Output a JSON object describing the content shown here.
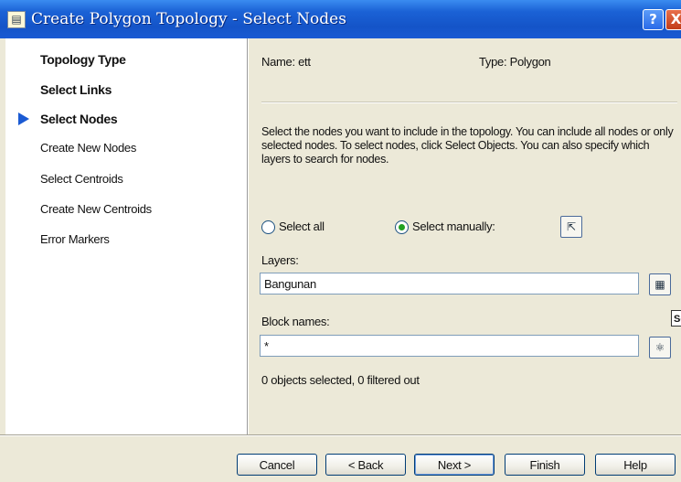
{
  "window": {
    "title": "Create Polygon Topology - Select Nodes",
    "help_label": "?",
    "close_label": "X",
    "app_icon": "map-wizard-icon"
  },
  "sidebar": {
    "steps": [
      {
        "label": "Topology Type",
        "bold": true
      },
      {
        "label": "Select Links",
        "bold": true
      },
      {
        "label": "Select Nodes",
        "bold": true,
        "current": true
      },
      {
        "label": "Create New Nodes",
        "bold": false
      },
      {
        "label": "Select Centroids",
        "bold": false
      },
      {
        "label": "Create New Centroids",
        "bold": false
      },
      {
        "label": "Error Markers",
        "bold": false
      }
    ]
  },
  "main": {
    "name_text": "Name: ett",
    "type_text": "Type: Polygon",
    "description": "Select the nodes you want to include in the topology. You can include all nodes or only selected nodes. To select nodes, click Select Objects. You can also specify which layers to search for nodes.",
    "radio_select_all": "Select all",
    "radio_select_manually": "Select manually:",
    "selected_radio": "Select manually:",
    "layers_label": "Layers:",
    "layers_value": "Bangunan",
    "block_names_label": "Block names:",
    "block_names_value": "*",
    "clipped_label": "Se",
    "status_text": "0 objects selected, 0 filtered out"
  },
  "buttons": {
    "cancel": "Cancel",
    "back": "< Back",
    "next": "Next >",
    "finish": "Finish",
    "help": "Help"
  },
  "colors": {
    "title_bar": "#1454c8",
    "radio_selected": "#21a121",
    "current_step_arrow": "#1a5ad3"
  }
}
